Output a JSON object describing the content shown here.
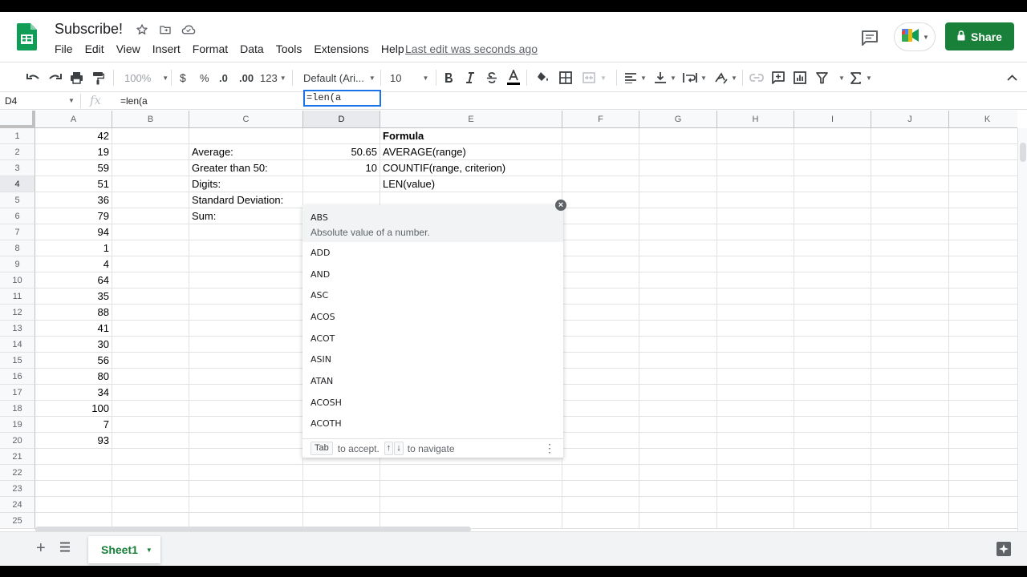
{
  "document": {
    "title": "Subscribe!",
    "last_edit": "Last edit was seconds ago",
    "share_label": "Share"
  },
  "menu": [
    "File",
    "Edit",
    "View",
    "Insert",
    "Format",
    "Data",
    "Tools",
    "Extensions",
    "Help"
  ],
  "toolbar": {
    "zoom": "100%",
    "currency": "$",
    "percent": "%",
    "decrease_decimal": ".0",
    "increase_decimal": ".00",
    "number_format": "123",
    "font": "Default (Ari...",
    "font_size": "10"
  },
  "formula_bar": {
    "cell_ref": "D4",
    "fx": "fx",
    "formula": "=len(a"
  },
  "columns": [
    "A",
    "B",
    "C",
    "D",
    "E",
    "F",
    "G",
    "H",
    "I",
    "J",
    "K"
  ],
  "rows": [
    "1",
    "2",
    "3",
    "4",
    "5",
    "6",
    "7",
    "8",
    "9",
    "10",
    "11",
    "12",
    "13",
    "14",
    "15",
    "16",
    "17",
    "18",
    "19",
    "20",
    "21",
    "22",
    "23",
    "24",
    "25"
  ],
  "column_a": [
    "42",
    "19",
    "59",
    "51",
    "36",
    "79",
    "94",
    "1",
    "4",
    "64",
    "35",
    "88",
    "41",
    "30",
    "56",
    "80",
    "34",
    "100",
    "7",
    "93"
  ],
  "labels_c": [
    "",
    "Average:",
    "Greater than 50:",
    "Digits:",
    "Standard Deviation:",
    "Sum:"
  ],
  "values_d": [
    "",
    "50.65",
    "10",
    "",
    "",
    ""
  ],
  "formulas_e": [
    "Formula",
    "AVERAGE(range)",
    "COUNTIF(range, criterion)",
    "LEN(value)"
  ],
  "active_cell": {
    "ref": "D4",
    "content": "=len(a"
  },
  "autocomplete": {
    "first": {
      "name": "ABS",
      "description": "Absolute value of a number."
    },
    "items": [
      "ADD",
      "AND",
      "ASC",
      "ACOS",
      "ACOT",
      "ASIN",
      "ATAN",
      "ACOSH",
      "ACOTH"
    ],
    "footer": {
      "tab_key": "Tab",
      "accept_text": "to accept.",
      "up_key": "↑",
      "down_key": "↓",
      "navigate_text": "to navigate"
    }
  },
  "sheet": {
    "name": "Sheet1"
  },
  "colors": {
    "brand_green": "#188038",
    "selection_blue": "#1a73e8"
  }
}
